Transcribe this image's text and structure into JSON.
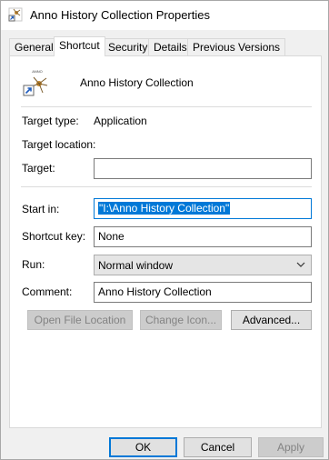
{
  "window": {
    "title": "Anno History Collection Properties"
  },
  "tabs": [
    {
      "label": "General",
      "active": false
    },
    {
      "label": "Shortcut",
      "active": true
    },
    {
      "label": "Security",
      "active": false
    },
    {
      "label": "Details",
      "active": false
    },
    {
      "label": "Previous Versions",
      "active": false
    }
  ],
  "shortcut": {
    "name": "Anno History Collection",
    "target_type_label": "Target type:",
    "target_type_value": "Application",
    "target_location_label": "Target location:",
    "target_location_value": "",
    "target_label": "Target:",
    "target_value": "",
    "start_in_label": "Start in:",
    "start_in_value": "\"I:\\Anno History Collection\"",
    "shortcut_key_label": "Shortcut key:",
    "shortcut_key_value": "None",
    "run_label": "Run:",
    "run_value": "Normal window",
    "comment_label": "Comment:",
    "comment_value": "Anno History Collection",
    "open_file_location_label": "Open File Location",
    "change_icon_label": "Change Icon...",
    "advanced_label": "Advanced..."
  },
  "footer": {
    "ok_label": "OK",
    "cancel_label": "Cancel",
    "apply_label": "Apply"
  },
  "colors": {
    "accent": "#0078d7",
    "panel_bg": "#ffffff",
    "dialog_bg": "#f0f0f0"
  }
}
